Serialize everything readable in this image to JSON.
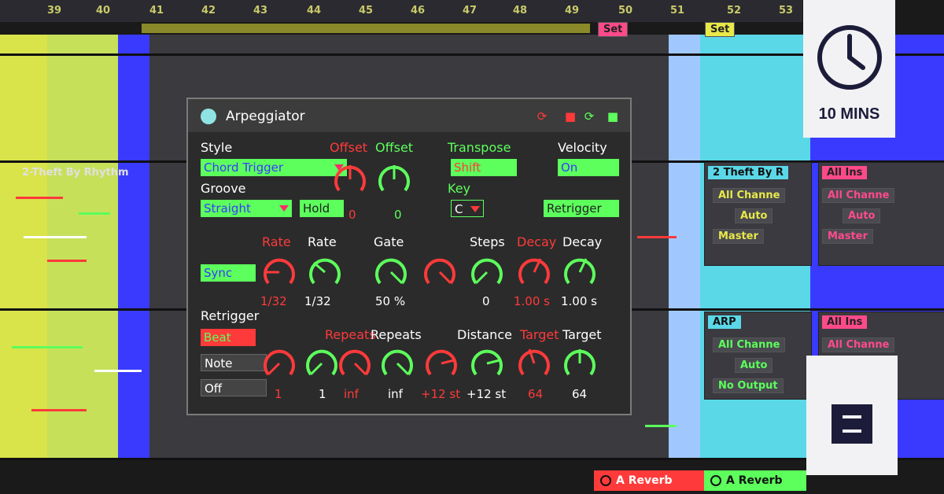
{
  "ruler": {
    "ticks": [
      "39",
      "40",
      "41",
      "42",
      "43",
      "44",
      "45",
      "46",
      "47",
      "48",
      "49",
      "50",
      "51",
      "52",
      "53"
    ]
  },
  "tracks": {
    "left_clip_name": "2-Theft By Rhythm",
    "right_track_name": "2 Theft By R",
    "arp_track_name": "ARP",
    "input_label": "All Ins",
    "channel_label": "All Channe",
    "auto_label": "Auto",
    "master_label": "Master",
    "no_output_label": "No Output",
    "set_label": "Set"
  },
  "bottom_clips": [
    "A Reverb",
    "A Reverb"
  ],
  "device": {
    "title": "Arpeggiator",
    "style_label": "Style",
    "style_value": "Chord Trigger",
    "groove_label": "Groove",
    "groove_value": "Straight",
    "hold_label": "Hold",
    "offset_label": "Offset",
    "offset_value": "0",
    "transpose_label": "Transpose",
    "transpose_value": "Shift",
    "key_label": "Key",
    "key_value": "C",
    "velocity_label": "Velocity",
    "velocity_value": "On",
    "retrigger_toggle": "Retrigger",
    "rate_label": "Rate",
    "rate_value": "1/32",
    "sync_label": "Sync",
    "gate_label": "Gate",
    "gate_value": "50 %",
    "steps_label": "Steps",
    "steps_value": "0",
    "decay_label": "Decay",
    "decay_value": "1.00 s",
    "retrigger_label": "Retrigger",
    "beat_label": "Beat",
    "note_label": "Note",
    "off_label": "Off",
    "repeats_label": "Repeats",
    "repeats_value": "inf",
    "repeats_value_alt": "1",
    "distance_label": "Distance",
    "distance_value": "+12 st",
    "target_label": "Target",
    "target_value": "64"
  },
  "badges": {
    "duration": "10 MINS",
    "clock_icon": "clock-icon",
    "logo_icon": "brand-logo-icon"
  },
  "colors": {
    "red": "#ff3a3a",
    "green": "#5cff5c",
    "blue": "#3a3aff",
    "yellow": "#e8e84a",
    "cyan": "#8fe3e3",
    "badge_bg": "#f2f2f5",
    "badge_text": "#1c1c3a"
  }
}
